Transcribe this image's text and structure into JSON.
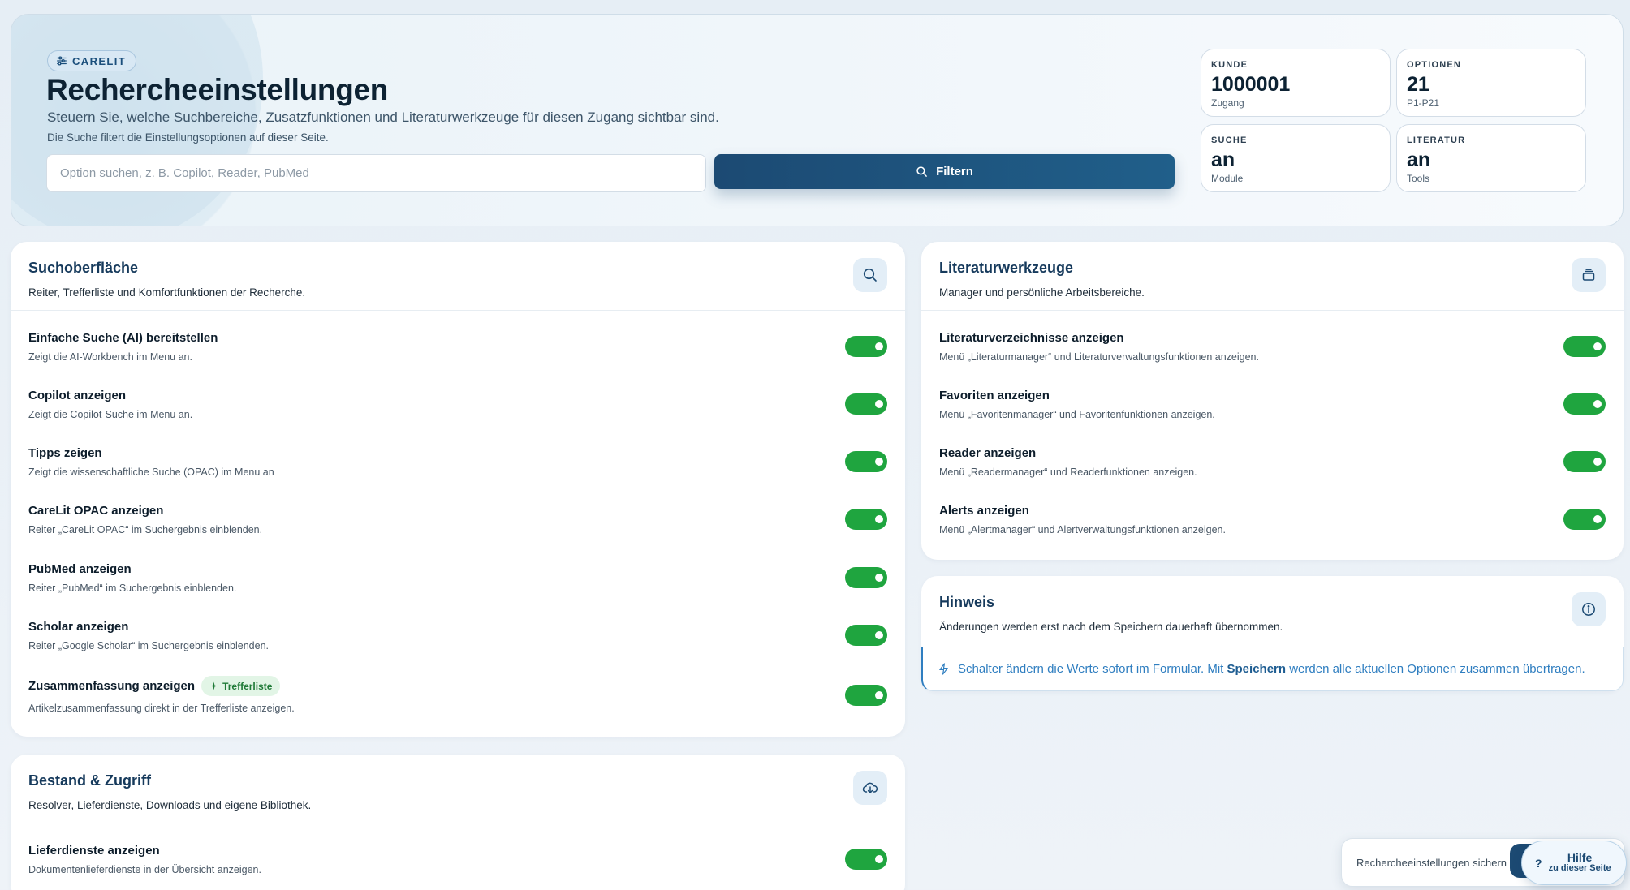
{
  "hero": {
    "badge": "CARELIT",
    "title": "Rechercheeinstellungen",
    "subtitle": "Steuern Sie, welche Suchbereiche, Zusatzfunktionen und Literaturwerkzeuge für diesen Zugang sichtbar sind.",
    "hint": "Die Suche filtert die Einstellungsoptionen auf dieser Seite.",
    "search_placeholder": "Option suchen, z. B. Copilot, Reader, PubMed",
    "search_value": "",
    "filter_label": "Filtern"
  },
  "stats": [
    {
      "label": "KUNDE",
      "value": "1000001",
      "caption": "Zugang"
    },
    {
      "label": "OPTIONEN",
      "value": "21",
      "caption": "P1-P21"
    },
    {
      "label": "SUCHE",
      "value": "an",
      "caption": "Module"
    },
    {
      "label": "LITERATUR",
      "value": "an",
      "caption": "Tools"
    }
  ],
  "search_card": {
    "title": "Suchoberfläche",
    "desc": "Reiter, Trefferliste und Komfortfunktionen der Recherche.",
    "icon": "search-icon",
    "options": [
      {
        "title": "Einfache Suche (AI) bereitstellen",
        "desc": "Zeigt die AI-Workbench im Menu an.",
        "on": true
      },
      {
        "title": "Copilot anzeigen",
        "desc": "Zeigt die Copilot-Suche im Menu an.",
        "on": true
      },
      {
        "title": "Tipps zeigen",
        "desc": "Zeigt die wissenschaftliche Suche (OPAC) im Menu an",
        "on": true
      },
      {
        "title": "CareLit OPAC anzeigen",
        "desc": "Reiter „CareLit OPAC“ im Suchergebnis einblenden.",
        "on": true
      },
      {
        "title": "PubMed anzeigen",
        "desc": "Reiter „PubMed“ im Suchergebnis einblenden.",
        "on": true
      },
      {
        "title": "Scholar anzeigen",
        "desc": "Reiter „Google Scholar“ im Suchergebnis einblenden.",
        "on": true
      },
      {
        "title": "Zusammenfassung anzeigen",
        "desc": "Artikelzusammenfassung direkt in der Trefferliste anzeigen.",
        "on": true,
        "pill": "Trefferliste"
      }
    ]
  },
  "access_card": {
    "title": "Bestand & Zugriff",
    "desc": "Resolver, Lieferdienste, Downloads und eigene Bibliothek.",
    "icon": "cloud-download-icon",
    "options": [
      {
        "title": "Lieferdienste anzeigen",
        "desc": "Dokumentenlieferdienste in der Übersicht anzeigen.",
        "on": true
      }
    ]
  },
  "lit_card": {
    "title": "Literaturwerkzeuge",
    "desc": "Manager und persönliche Arbeitsbereiche.",
    "icon": "stack-icon",
    "options": [
      {
        "title": "Literaturverzeichnisse anzeigen",
        "desc": "Menü „Literaturmanager“ und Literaturverwaltungsfunktionen anzeigen.",
        "on": true
      },
      {
        "title": "Favoriten anzeigen",
        "desc": "Menü „Favoritenmanager“ und Favoritenfunktionen anzeigen.",
        "on": true
      },
      {
        "title": "Reader anzeigen",
        "desc": "Menü „Readermanager“ und Readerfunktionen anzeigen.",
        "on": true
      },
      {
        "title": "Alerts anzeigen",
        "desc": "Menü „Alertmanager“ und Alertverwaltungsfunktionen anzeigen.",
        "on": true
      }
    ]
  },
  "note_card": {
    "title": "Hinweis",
    "desc": "Änderungen werden erst nach dem Speichern dauerhaft übernommen.",
    "icon": "info-icon",
    "info_pre": "Schalter ändern die Werte sofort im Formular. Mit",
    "info_bold": "Speichern",
    "info_post": "werden alle aktuellen Optionen zusammen übertragen."
  },
  "footer": {
    "save_text": "Rechercheeinstellungen sichern",
    "help_q": "?",
    "help_title": "Hilfe",
    "help_sub": "zu dieser Seite"
  },
  "colors": {
    "primary": "#1c4a73",
    "toggle_on": "#1fa53f",
    "accent": "#2f7ec0"
  }
}
